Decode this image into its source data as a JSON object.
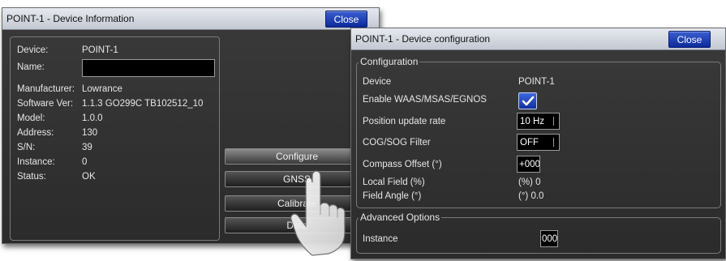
{
  "device_info": {
    "title": "POINT-1 - Device Information",
    "close_label": "Close",
    "fields": {
      "device_label": "Device:",
      "device_value": "POINT-1",
      "name_label": "Name:",
      "name_value": "",
      "manufacturer_label": "Manufacturer:",
      "manufacturer_value": "Lowrance",
      "software_label": "Software Ver:",
      "software_value": "1.1.3 GO299C TB102512_10",
      "model_label": "Model:",
      "model_value": "1.0.0",
      "address_label": "Address:",
      "address_value": "130",
      "sn_label": "S/N:",
      "sn_value": "39",
      "instance_label": "Instance:",
      "instance_value": "0",
      "status_label": "Status:",
      "status_value": "OK"
    },
    "buttons": {
      "configure": "Configure",
      "gnss": "GNSS",
      "calibrate": "Calibrate",
      "data": "Data"
    }
  },
  "device_config": {
    "title": "POINT-1 - Device configuration",
    "close_label": "Close",
    "configuration_legend": "Configuration",
    "device_label": "Device",
    "device_value": "POINT-1",
    "waas_label": "Enable WAAS/MSAS/EGNOS",
    "waas_checked": true,
    "update_rate_label": "Position update rate",
    "update_rate_value": "10 Hz",
    "cog_label": "COG/SOG Filter",
    "cog_value": "OFF",
    "compass_label": "Compass Offset (°)",
    "compass_value": "+000",
    "local_field_label": "Local Field (%)",
    "local_field_value": "(%) 0",
    "field_angle_label": "Field Angle (°)",
    "field_angle_value": "(°) 0.0",
    "advanced_legend": "Advanced Options",
    "instance_label": "Instance",
    "instance_value": "000"
  },
  "colors": {
    "dialog_bg": "#2f2f2f",
    "titlebar": "#d6dae2",
    "close_button": "#1a3cb0",
    "checkbox": "#2450c8"
  }
}
